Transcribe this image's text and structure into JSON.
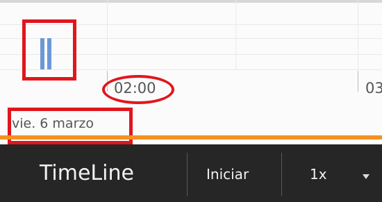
{
  "timeline": {
    "ticks": [
      "02:00",
      "03"
    ],
    "date_label": "vie. 6 marzo",
    "bar_icon": "pause-bars-icon"
  },
  "toolbar": {
    "title": "TimeLine",
    "start_label": "Iniciar",
    "speed_value": "1x",
    "caret_icon": "caret-down-icon"
  },
  "colors": {
    "accent": "#f4921f",
    "toolbar_bg": "#262626",
    "highlight": "#e0161d",
    "bar": "#6b99d6"
  }
}
